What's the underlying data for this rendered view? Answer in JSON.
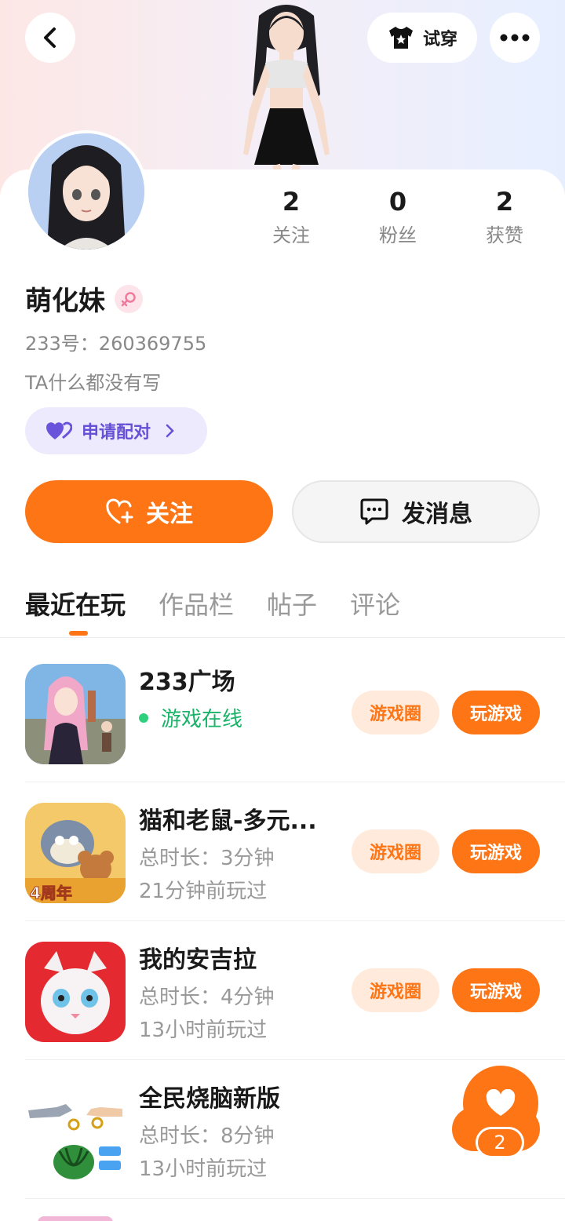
{
  "header": {
    "try_on_label": "试穿"
  },
  "profile": {
    "name": "萌化妹",
    "uid_text": "233号：260369755",
    "bio": "TA什么都没有写",
    "pair_label": "申请配对",
    "stats": [
      {
        "value": "2",
        "label": "关注"
      },
      {
        "value": "0",
        "label": "粉丝"
      },
      {
        "value": "2",
        "label": "获赞"
      }
    ]
  },
  "actions": {
    "follow_label": "关注",
    "message_label": "发消息"
  },
  "tabs": [
    "最近在玩",
    "作品栏",
    "帖子",
    "评论"
  ],
  "games": [
    {
      "title": "233广场",
      "status": "游戏在线",
      "circle_label": "游戏圈",
      "play_label": "玩游戏",
      "icon": "game-233-plaza-icon"
    },
    {
      "title": "猫和老鼠-多元...",
      "duration": "总时长：3分钟",
      "last_played": "21分钟前玩过",
      "circle_label": "游戏圈",
      "play_label": "玩游戏",
      "icon": "tom-and-jerry-icon",
      "badge": "4周年"
    },
    {
      "title": "我的安吉拉",
      "duration": "总时长：4分钟",
      "last_played": "13小时前玩过",
      "circle_label": "游戏圈",
      "play_label": "玩游戏",
      "icon": "angela-icon"
    },
    {
      "title": "全民烧脑新版",
      "duration": "总时长：8分钟",
      "last_played": "13小时前玩过",
      "icon": "brain-puzzle-icon"
    }
  ],
  "fab": {
    "count": "2"
  },
  "colors": {
    "accent": "#fe7516",
    "online": "#19b369",
    "pair": "#6650d6"
  }
}
